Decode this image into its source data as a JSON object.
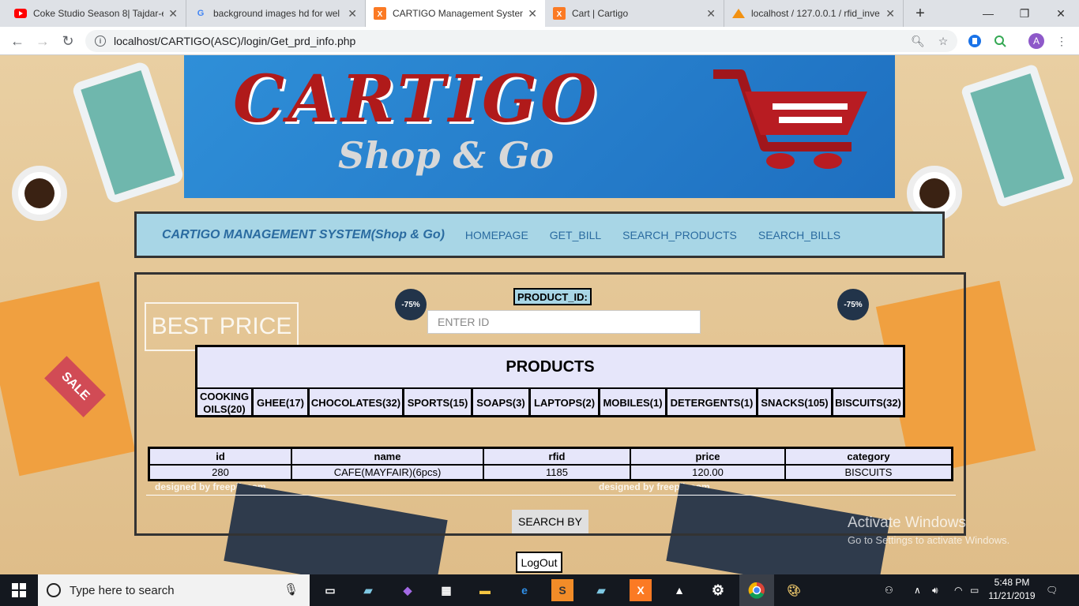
{
  "browser": {
    "tabs": [
      {
        "title": "Coke Studio Season 8| Tajdar-e",
        "icon": "youtube-icon",
        "color": "#ff0000"
      },
      {
        "title": "background images hd for wel",
        "icon": "google-icon",
        "color": "#4285f4"
      },
      {
        "title": "CARTIGO Management System",
        "icon": "xampp-icon",
        "color": "#fb7a24"
      },
      {
        "title": "Cart | Cartigo",
        "icon": "xampp-icon",
        "color": "#fb7a24"
      },
      {
        "title": "localhost / 127.0.0.1 / rfid_inve",
        "icon": "phpmyadmin-icon",
        "color": "#f29111"
      }
    ],
    "active_tab": 2,
    "url": "localhost/CARTIGO(ASC)/login/Get_prd_info.php",
    "profile_initial": "A"
  },
  "banner": {
    "logo_text": "CARTIGO",
    "tagline": "Shop & Go"
  },
  "nav": {
    "brand": "CARTIGO MANAGEMENT SYSTEM(Shop & Go)",
    "links": [
      "HOMEPAGE",
      "GET_BILL",
      "SEARCH_PRODUCTS",
      "SEARCH_BILLS"
    ]
  },
  "form": {
    "product_id_label": "PRODUCT_ID:",
    "product_id_placeholder": "ENTER ID",
    "search_button": "SEARCH BY",
    "logout_button": "LogOut"
  },
  "products": {
    "title": "PRODUCTS",
    "categories": [
      "COOKING OILS(20)",
      "GHEE(17)",
      "CHOCOLATES(32)",
      "SPORTS(15)",
      "SOAPS(3)",
      "LAPTOPS(2)",
      "MOBILES(1)",
      "DETERGENTS(1)",
      "SNACKS(105)",
      "BISCUITS(32)"
    ]
  },
  "result": {
    "columns": [
      "id",
      "name",
      "rfid",
      "price",
      "category"
    ],
    "rows": [
      [
        "280",
        "CAFE(MAYFAIR)(6pcs)",
        "1185",
        "120.00",
        "BISCUITS"
      ]
    ]
  },
  "background": {
    "texts": [
      "BEST PRICE",
      "SALE",
      "designed by freepik.com",
      "-75%"
    ]
  },
  "watermark": {
    "line1": "Activate Windows",
    "line2": "Go to Settings to activate Windows."
  },
  "taskbar": {
    "search_placeholder": "Type here to search",
    "time": "5:48 PM",
    "date": "11/21/2019"
  }
}
